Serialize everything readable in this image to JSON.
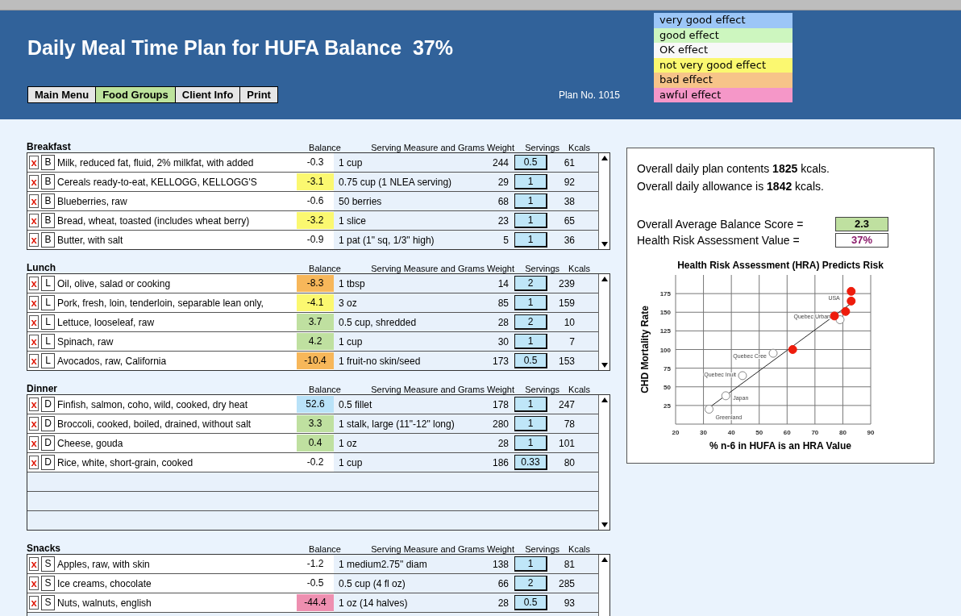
{
  "header": {
    "title": "Daily Meal Time Plan for HUFA Balance  37%",
    "plan_no": "Plan No. 1015"
  },
  "nav": [
    {
      "label": "Main Menu",
      "selected": false
    },
    {
      "label": "Food Groups",
      "selected": true
    },
    {
      "label": "Client Info",
      "selected": false
    },
    {
      "label": "Print",
      "selected": false
    }
  ],
  "legend": [
    {
      "label": "very good effect",
      "color": "#9cc6f7"
    },
    {
      "label": "good effect",
      "color": "#cdf6bf"
    },
    {
      "label": "OK effect",
      "color": "#f8f8f8"
    },
    {
      "label": "not very good effect",
      "color": "#fbf870"
    },
    {
      "label": "bad effect",
      "color": "#f7c489"
    },
    {
      "label": "awful effect",
      "color": "#f597c8"
    }
  ],
  "meals": [
    {
      "title": "Breakfast",
      "columns": [
        "Balance",
        "Serving Measure and Grams Weight",
        "Servings",
        "Kcals"
      ],
      "rows": [
        {
          "delete": "x",
          "letter": "B",
          "food": "Milk, reduced fat, fluid, 2% milkfat, with added",
          "balance": "-0.3",
          "color": "#ffffff",
          "measure": "1 cup",
          "weight": "244",
          "servings": "0.5",
          "kcals": "61"
        },
        {
          "delete": "x",
          "letter": "B",
          "food": "Cereals ready-to-eat, KELLOGG, KELLOGG'S",
          "balance": "-3.1",
          "color": "#fbf870",
          "measure": "0.75 cup (1 NLEA serving)",
          "weight": "29",
          "servings": "1",
          "kcals": "92"
        },
        {
          "delete": "x",
          "letter": "B",
          "food": "Blueberries, raw",
          "balance": "-0.6",
          "color": "#ffffff",
          "measure": "50 berries",
          "weight": "68",
          "servings": "1",
          "kcals": "38"
        },
        {
          "delete": "x",
          "letter": "B",
          "food": "Bread, wheat, toasted (includes wheat berry)",
          "balance": "-3.2",
          "color": "#fbf870",
          "measure": "1 slice",
          "weight": "23",
          "servings": "1",
          "kcals": "65"
        },
        {
          "delete": "x",
          "letter": "B",
          "food": "Butter, with salt",
          "balance": "-0.9",
          "color": "#ffffff",
          "measure": "1 pat (1\" sq, 1/3\" high)",
          "weight": "5",
          "servings": "1",
          "kcals": "36"
        }
      ]
    },
    {
      "title": "Lunch",
      "columns": [
        "Balance",
        "Serving Measure and Grams Weight",
        "Servings",
        "Kcals"
      ],
      "rows": [
        {
          "delete": "x",
          "letter": "L",
          "food": "Oil, olive, salad or cooking",
          "balance": "-8.3",
          "color": "#f7b75a",
          "measure": "1 tbsp",
          "weight": "14",
          "servings": "2",
          "kcals": "239"
        },
        {
          "delete": "x",
          "letter": "L",
          "food": "Pork, fresh, loin, tenderloin, separable lean only,",
          "balance": "-4.1",
          "color": "#fbf870",
          "measure": "3 oz",
          "weight": "85",
          "servings": "1",
          "kcals": "159"
        },
        {
          "delete": "x",
          "letter": "L",
          "food": "Lettuce, looseleaf, raw",
          "balance": "3.7",
          "color": "#bfe0a0",
          "measure": "0.5 cup, shredded",
          "weight": "28",
          "servings": "2",
          "kcals": "10"
        },
        {
          "delete": "x",
          "letter": "L",
          "food": "Spinach, raw",
          "balance": "4.2",
          "color": "#bfe0a0",
          "measure": "1 cup",
          "weight": "30",
          "servings": "1",
          "kcals": "7"
        },
        {
          "delete": "x",
          "letter": "L",
          "food": "Avocados, raw, California",
          "balance": "-10.4",
          "color": "#f7b75a",
          "measure": "1 fruit-no skin/seed",
          "weight": "173",
          "servings": "0.5",
          "kcals": "153"
        }
      ]
    },
    {
      "title": "Dinner",
      "columns": [
        "Balance",
        "Serving Measure and Grams Weight",
        "Servings",
        "Kcals"
      ],
      "rows": [
        {
          "delete": "x",
          "letter": "D",
          "food": "Finfish, salmon, coho, wild, cooked, dry heat",
          "balance": "52.6",
          "color": "#b9e2f8",
          "measure": "0.5 fillet",
          "weight": "178",
          "servings": "1",
          "kcals": "247"
        },
        {
          "delete": "x",
          "letter": "D",
          "food": "Broccoli, cooked, boiled, drained, without salt",
          "balance": "3.3",
          "color": "#bfe0a0",
          "measure": "1 stalk, large (11\"-12\" long)",
          "weight": "280",
          "servings": "1",
          "kcals": "78"
        },
        {
          "delete": "x",
          "letter": "D",
          "food": "Cheese, gouda",
          "balance": "0.4",
          "color": "#bfe0a0",
          "measure": "1 oz",
          "weight": "28",
          "servings": "1",
          "kcals": "101"
        },
        {
          "delete": "x",
          "letter": "D",
          "food": "Rice, white, short-grain, cooked",
          "balance": "-0.2",
          "color": "#ffffff",
          "measure": "1 cup",
          "weight": "186",
          "servings": "0.33",
          "kcals": "80"
        },
        {
          "kind": "blank"
        },
        {
          "kind": "blank"
        },
        {
          "kind": "blank"
        }
      ]
    },
    {
      "title": "Snacks",
      "columns": [
        "Balance",
        "Serving Measure and Grams Weight",
        "Servings",
        "Kcals"
      ],
      "rows": [
        {
          "delete": "x",
          "letter": "S",
          "food": "Apples, raw, with skin",
          "balance": "-1.2",
          "color": "#ffffff",
          "measure": "1 medium2.75\" diam",
          "weight": "138",
          "servings": "1",
          "kcals": "81"
        },
        {
          "delete": "x",
          "letter": "S",
          "food": "Ice creams, chocolate",
          "balance": "-0.5",
          "color": "#ffffff",
          "measure": "0.5 cup (4 fl oz)",
          "weight": "66",
          "servings": "2",
          "kcals": "285"
        },
        {
          "delete": "x",
          "letter": "S",
          "food": "Nuts, walnuts, english",
          "balance": "-44.4",
          "color": "#ee8fb0",
          "measure": "1 oz (14 halves)",
          "weight": "28",
          "servings": "0.5",
          "kcals": "93"
        },
        {
          "kind": "blank"
        }
      ]
    }
  ],
  "summary": {
    "lines": [
      "Overall daily plan contents **1825** kcals.",
      "Overall daily allowance is **1842** kcals."
    ],
    "score_label": "Overall Average Balance Score =",
    "score": "2.3",
    "hra_label": "Health Risk Assessment Value  =",
    "hra": "37%",
    "chart_data": {
      "type": "scatter",
      "title": "Health Risk Assessment (HRA) Predicts Risk",
      "xlabel": "% n-6 in HUFA is an HRA Value",
      "ylabel": "CHD Mortality Rate",
      "xlim": [
        20,
        90
      ],
      "ylim": [
        0,
        200
      ],
      "xticks": [
        20,
        30,
        40,
        50,
        60,
        70,
        80,
        90
      ],
      "yticks": [
        25,
        50,
        75,
        100,
        125,
        150,
        175
      ],
      "series": [
        {
          "color": "#ffffff",
          "x": [
            32,
            38,
            44,
            55,
            79
          ],
          "values": [
            20,
            38,
            65,
            95,
            140
          ]
        },
        {
          "color": "#ee1c0c",
          "x": [
            62,
            77,
            81,
            83,
            83
          ],
          "values": [
            100,
            145,
            151,
            165,
            178
          ]
        },
        {
          "type": "line",
          "color": "#222222",
          "x": [
            32,
            83
          ],
          "values": [
            22,
            162
          ]
        }
      ],
      "grid": true,
      "annotations": [
        "Greenland",
        "Japan",
        "Quebec Inuit",
        "Quebec Cree",
        "Quebec Urban",
        "USA"
      ]
    }
  }
}
